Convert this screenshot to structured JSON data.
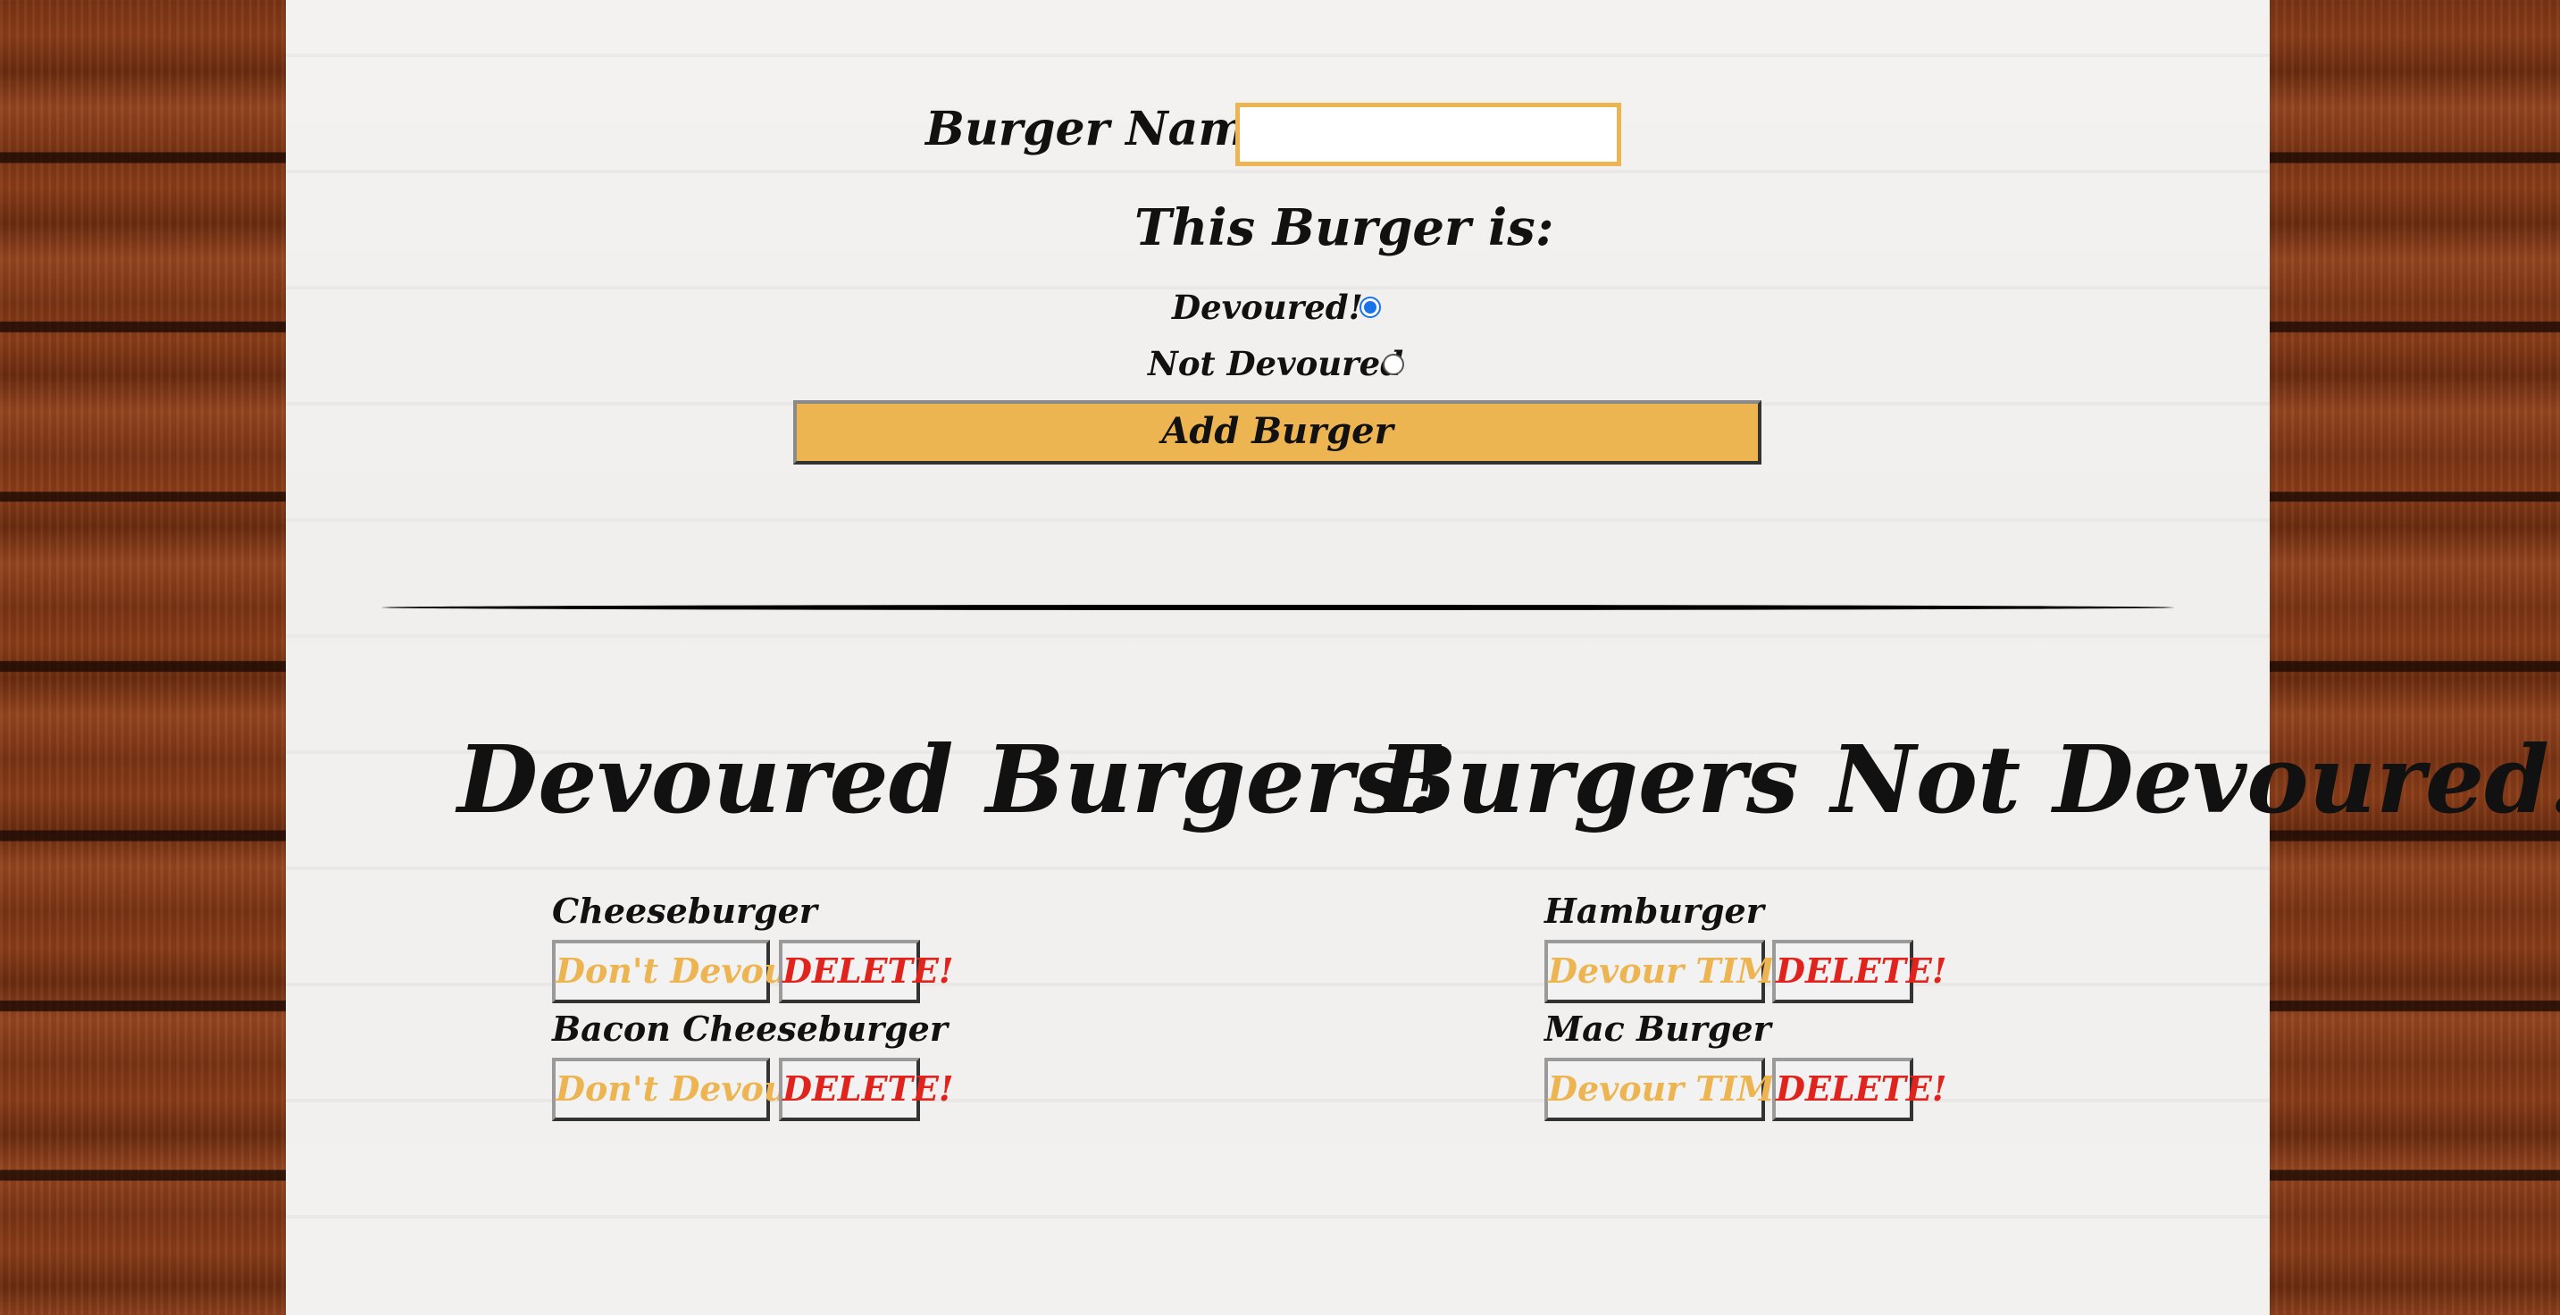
{
  "form": {
    "name_label": "Burger Name:",
    "name_value": "",
    "name_placeholder": "",
    "status_heading": "This Burger is:",
    "option_devoured": "Devoured!",
    "option_not_devoured": "Not Devoured",
    "selected_option": "Devoured!",
    "submit_label": "Add Burger"
  },
  "devoured": {
    "title": "Devoured Burgers!",
    "items": [
      {
        "name": "Cheeseburger",
        "toggle_label": "Don't Devour!",
        "delete_label": "DELETE!"
      },
      {
        "name": "Bacon Cheeseburger",
        "toggle_label": "Don't Devour!",
        "delete_label": "DELETE!"
      }
    ]
  },
  "not_devoured": {
    "title": "Burgers Not Devoured!",
    "items": [
      {
        "name": "Hamburger",
        "toggle_label": "Devour TIME!",
        "delete_label": "DELETE!"
      },
      {
        "name": "Mac Burger",
        "toggle_label": "Devour TIME!",
        "delete_label": "DELETE!"
      }
    ]
  },
  "colors": {
    "accent": "#edb552",
    "delete": "#e0231d",
    "radio_selected": "#1a73e8",
    "wood": "#7a3414",
    "panel": "#f3f1ef"
  }
}
